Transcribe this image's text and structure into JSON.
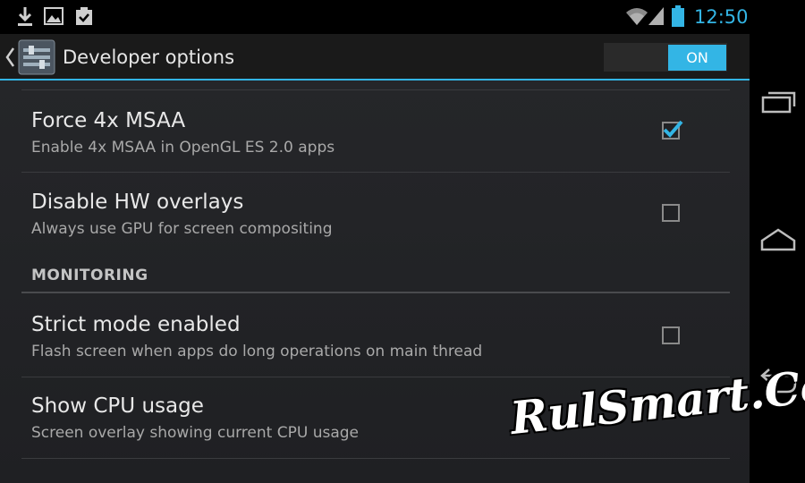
{
  "status_bar": {
    "time": "12:50",
    "left_icons": [
      "download-icon",
      "image-icon",
      "clipboard-check-icon"
    ],
    "right_icons": [
      "wifi-icon",
      "signal-icon",
      "battery-icon"
    ],
    "accent": "#33b5e5"
  },
  "action_bar": {
    "title": "Developer options",
    "master_switch": {
      "label": "ON",
      "state": true
    }
  },
  "settings": [
    {
      "title": "Force 4x MSAA",
      "summary": "Enable 4x MSAA in OpenGL ES 2.0 apps",
      "checked": true
    },
    {
      "title": "Disable HW overlays",
      "summary": "Always use GPU for screen compositing",
      "checked": false
    }
  ],
  "section": {
    "header": "MONITORING"
  },
  "monitoring": [
    {
      "title": "Strict mode enabled",
      "summary": "Flash screen when apps do long operations on main thread",
      "checked": false
    },
    {
      "title": "Show CPU usage",
      "summary": "Screen overlay showing current CPU usage",
      "checked": false
    }
  ],
  "nav_bar": [
    "recent-apps-icon",
    "home-icon",
    "back-icon"
  ],
  "watermark": "RulSmart.Com"
}
